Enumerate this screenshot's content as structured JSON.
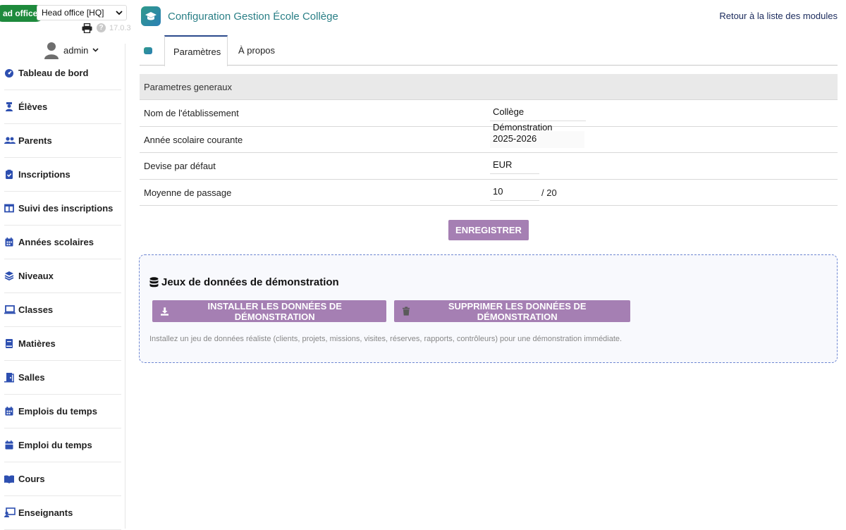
{
  "topbar": {
    "entity_badge": "ad office",
    "entity_select": "Head office [HQ]",
    "version": "17.0.3"
  },
  "user": {
    "name": "admin"
  },
  "menu": [
    {
      "label": "Tableau de bord",
      "icon": "dashboard-icon"
    },
    {
      "label": "Élèves",
      "icon": "student-icon"
    },
    {
      "label": "Parents",
      "icon": "users-icon"
    },
    {
      "label": "Inscriptions",
      "icon": "clipboard-check-icon"
    },
    {
      "label": "Suivi des inscriptions",
      "icon": "columns-icon"
    },
    {
      "label": "Années scolaires",
      "icon": "calendar-icon"
    },
    {
      "label": "Niveaux",
      "icon": "layers-icon"
    },
    {
      "label": "Classes",
      "icon": "laptop-icon"
    },
    {
      "label": "Matières",
      "icon": "book-icon"
    },
    {
      "label": "Salles",
      "icon": "door-icon"
    },
    {
      "label": "Emplois du temps",
      "icon": "calendar-icon"
    },
    {
      "label": "Emploi du temps",
      "icon": "calendar-day-icon"
    },
    {
      "label": "Cours",
      "icon": "open-book-icon"
    },
    {
      "label": "Enseignants",
      "icon": "teacher-icon"
    }
  ],
  "header": {
    "title": "Configuration Gestion École Collège",
    "back_link": "Retour à la liste des modules"
  },
  "tabs": [
    {
      "label": "Paramètres",
      "active": true
    },
    {
      "label": "À propos",
      "active": false
    }
  ],
  "params": {
    "section": "Parametres generaux",
    "rows": [
      {
        "label": "Nom de l'établissement",
        "value": "Collège Démonstration"
      },
      {
        "label": "Année scolaire courante",
        "value": "2025-2026"
      },
      {
        "label": "Devise par défaut",
        "value": "EUR"
      },
      {
        "label": "Moyenne de passage",
        "value": "10",
        "suffix": "/ 20"
      }
    ],
    "save_label": "ENREGISTRER"
  },
  "demo": {
    "title": "Jeux de données de démonstration",
    "install_label": "INSTALLER LES DONNÉES DE DÉMONSTRATION",
    "remove_label": "SUPPRIMER LES DONNÉES DE DÉMONSTRATION",
    "note": "Installez un jeu de données réaliste (clients, projets, missions, visites, réserves, rapports, contrôleurs) pour une démonstration immédiate."
  },
  "colors": {
    "accent": "#a57fb3",
    "title": "#2a7f86",
    "badge": "#1e8a3c",
    "icon": "#2d4fb0"
  }
}
